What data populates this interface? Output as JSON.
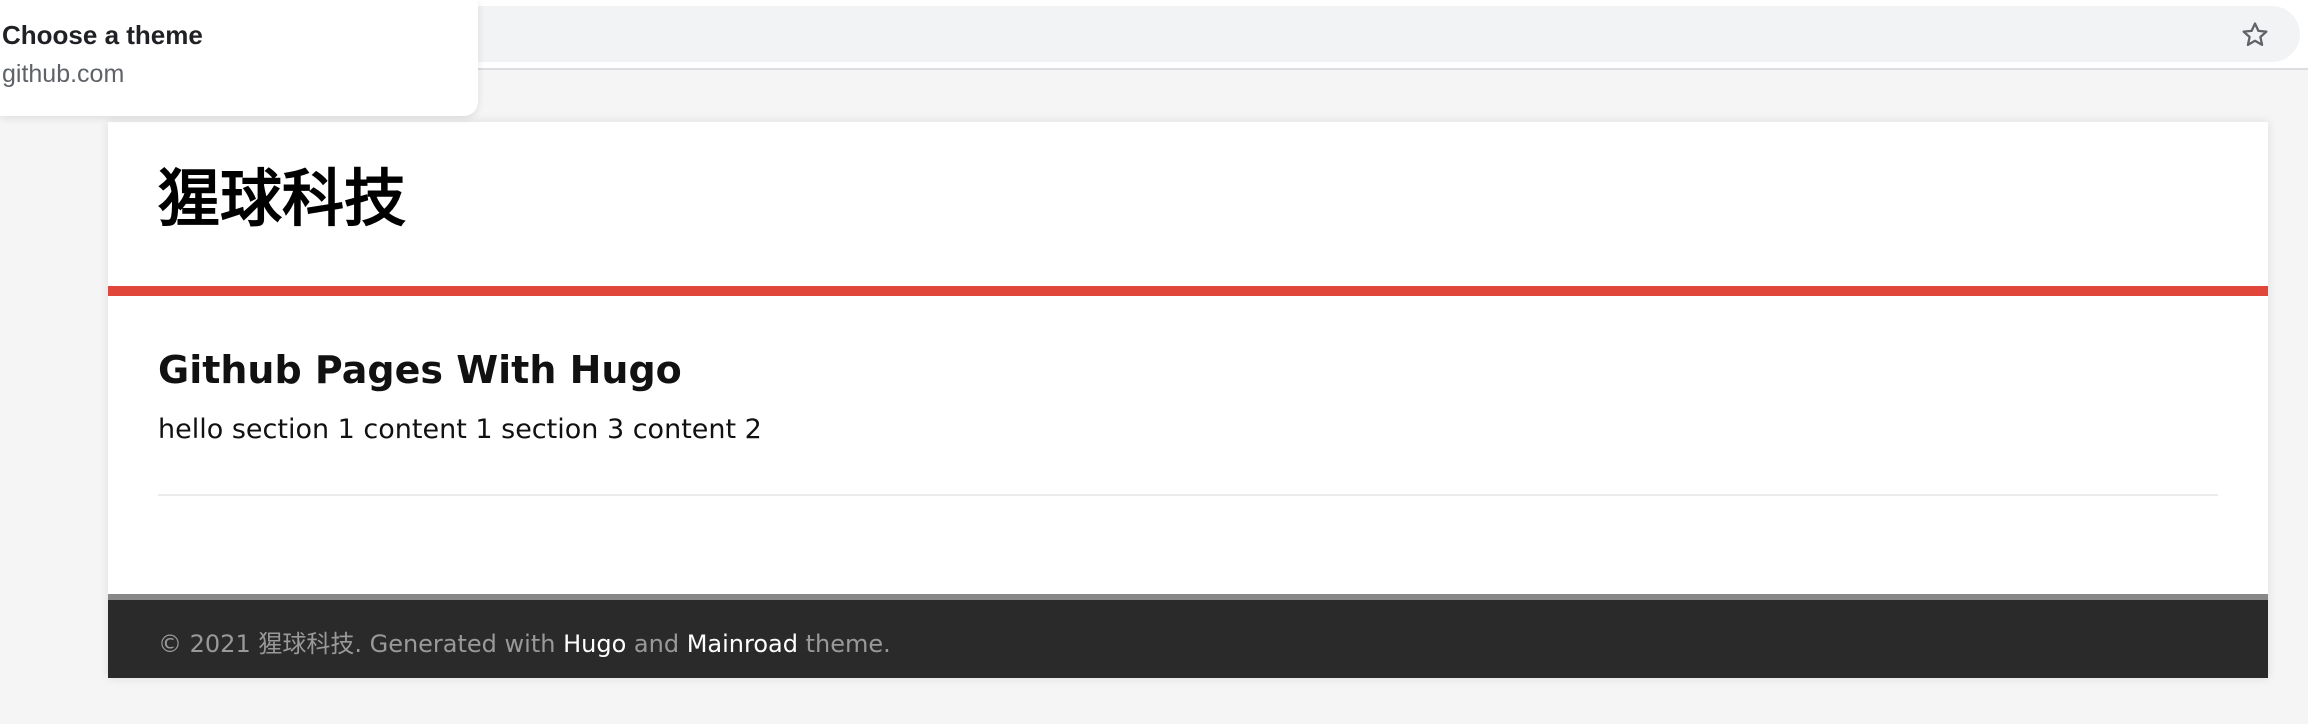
{
  "browser": {
    "tooltip": {
      "title": "Choose a theme",
      "url": "github.com"
    },
    "icons": {
      "star": "star-icon"
    }
  },
  "site": {
    "logo": "猩球科技",
    "accent_color": "#e0463a",
    "post": {
      "title": "Github Pages With Hugo",
      "content": "hello section 1 content 1 section 3 content 2"
    },
    "footer": {
      "prefix": "© 2021 猩球科技. Generated with ",
      "hugo_link": "Hugo",
      "and_text": " and ",
      "mainroad_link": "Mainroad",
      "suffix": " theme."
    }
  }
}
